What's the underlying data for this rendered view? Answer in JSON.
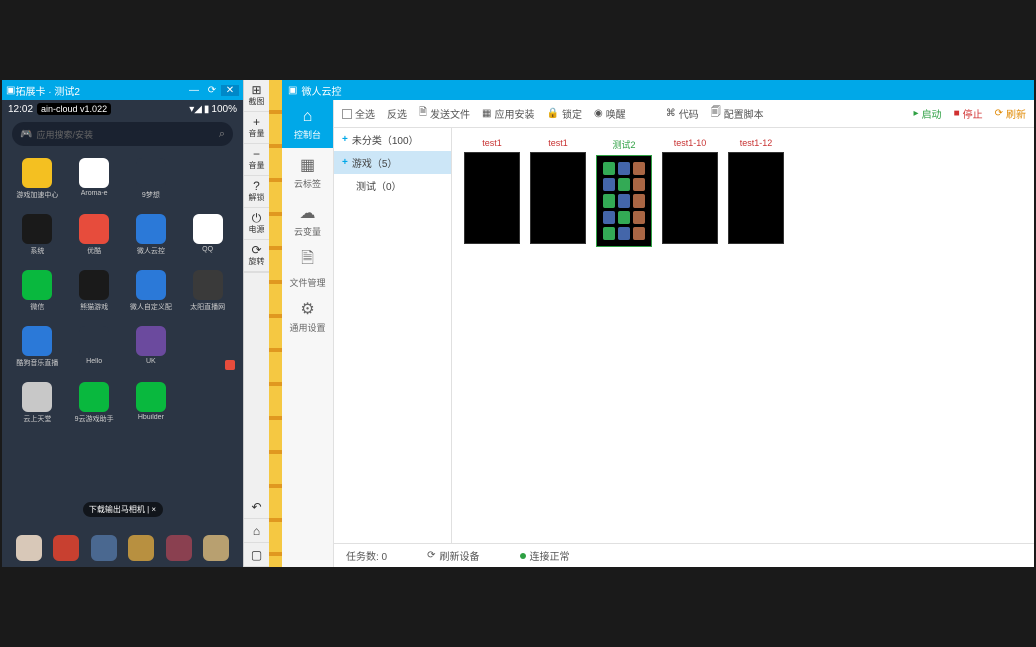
{
  "emu": {
    "title": "拓展卡 · 测试2",
    "status": {
      "time": "12:02",
      "badge": "ain-cloud v1.022",
      "battery": "100%"
    },
    "search": {
      "placeholder": "应用搜索/安装"
    },
    "apps": [
      {
        "label": "游戏加速中心",
        "color": "#f4c021"
      },
      {
        "label": "Aroma-e",
        "color": "#ffffff"
      },
      {
        "label": "9梦想",
        "color": "#2b3544"
      },
      {
        "label": "",
        "color": "transparent"
      },
      {
        "label": "系统",
        "color": "#1a1a1a"
      },
      {
        "label": "优酷",
        "color": "#e74c3c"
      },
      {
        "label": "微人云控",
        "color": "#2b79d8"
      },
      {
        "label": "QQ",
        "color": "#ffffff"
      },
      {
        "label": "微信",
        "color": "#09b83e"
      },
      {
        "label": "熊猫游戏",
        "color": "#1a1a1a"
      },
      {
        "label": "微人自定义配置",
        "color": "#2b79d8"
      },
      {
        "label": "太阳直播网",
        "color": "#3a3a3a"
      },
      {
        "label": "酷狗音乐直播",
        "color": "#2b79d8"
      },
      {
        "label": "Hello",
        "color": "#2b3544"
      },
      {
        "label": "UK",
        "color": "#6b4a9e"
      },
      {
        "label": "",
        "color": "transparent"
      },
      {
        "label": "云上天堂",
        "color": "#c8c8c8"
      },
      {
        "label": "9云游戏助手",
        "color": "#09b83e"
      },
      {
        "label": "Hbuilder",
        "color": "#09b83e"
      },
      {
        "label": "",
        "color": "transparent"
      }
    ],
    "bubble": "下载输出马相机 | ×",
    "dock": [
      {
        "color": "#d8c8b8"
      },
      {
        "color": "#c84030"
      },
      {
        "color": "#4a6890"
      },
      {
        "color": "#b89040"
      },
      {
        "color": "#8a4050"
      },
      {
        "color": "#b8a070"
      }
    ],
    "toolbar": [
      {
        "icon": "⊞",
        "label": "截图"
      },
      {
        "icon": "+",
        "label": "音量"
      },
      {
        "icon": "−",
        "label": "音量"
      },
      {
        "icon": "?",
        "label": "解锁"
      },
      {
        "icon": "⏻",
        "label": "电源"
      },
      {
        "icon": "⟳",
        "label": "旋转"
      }
    ],
    "nav_btns": [
      "↶",
      "⌂",
      "▢"
    ]
  },
  "cloud": {
    "title": "微人云控",
    "actions": {
      "select_all": "全选",
      "invert": "反选",
      "send_file": "发送文件",
      "install_app": "应用安装",
      "lock": "锁定",
      "wake": "唤醒",
      "code": "代码",
      "script": "配置脚本",
      "start": "启动",
      "stop": "停止",
      "refresh": "刷新"
    },
    "nav": [
      {
        "icon": "⌂",
        "label": "控制台"
      },
      {
        "icon": "▦",
        "label": "云标签"
      },
      {
        "icon": "☁",
        "label": "云变量"
      },
      {
        "icon": "🗎",
        "label": "文件管理"
      },
      {
        "icon": "⚙",
        "label": "通用设置"
      }
    ],
    "tree": [
      {
        "label": "未分类（100）",
        "type": "root"
      },
      {
        "label": "游戏（5）",
        "type": "root",
        "selected": true
      },
      {
        "label": "测试（0）",
        "type": "child"
      }
    ],
    "devices": [
      {
        "label": "test1",
        "cls": "red",
        "active": false
      },
      {
        "label": "test1",
        "cls": "red",
        "active": false
      },
      {
        "label": "测试2",
        "cls": "green",
        "active": true
      },
      {
        "label": "test1-10",
        "cls": "red",
        "active": false
      },
      {
        "label": "test1-12",
        "cls": "red",
        "active": false
      }
    ],
    "status": {
      "tasks": "任务数: 0",
      "refresh": "刷新设备",
      "conn": "连接正常"
    }
  }
}
